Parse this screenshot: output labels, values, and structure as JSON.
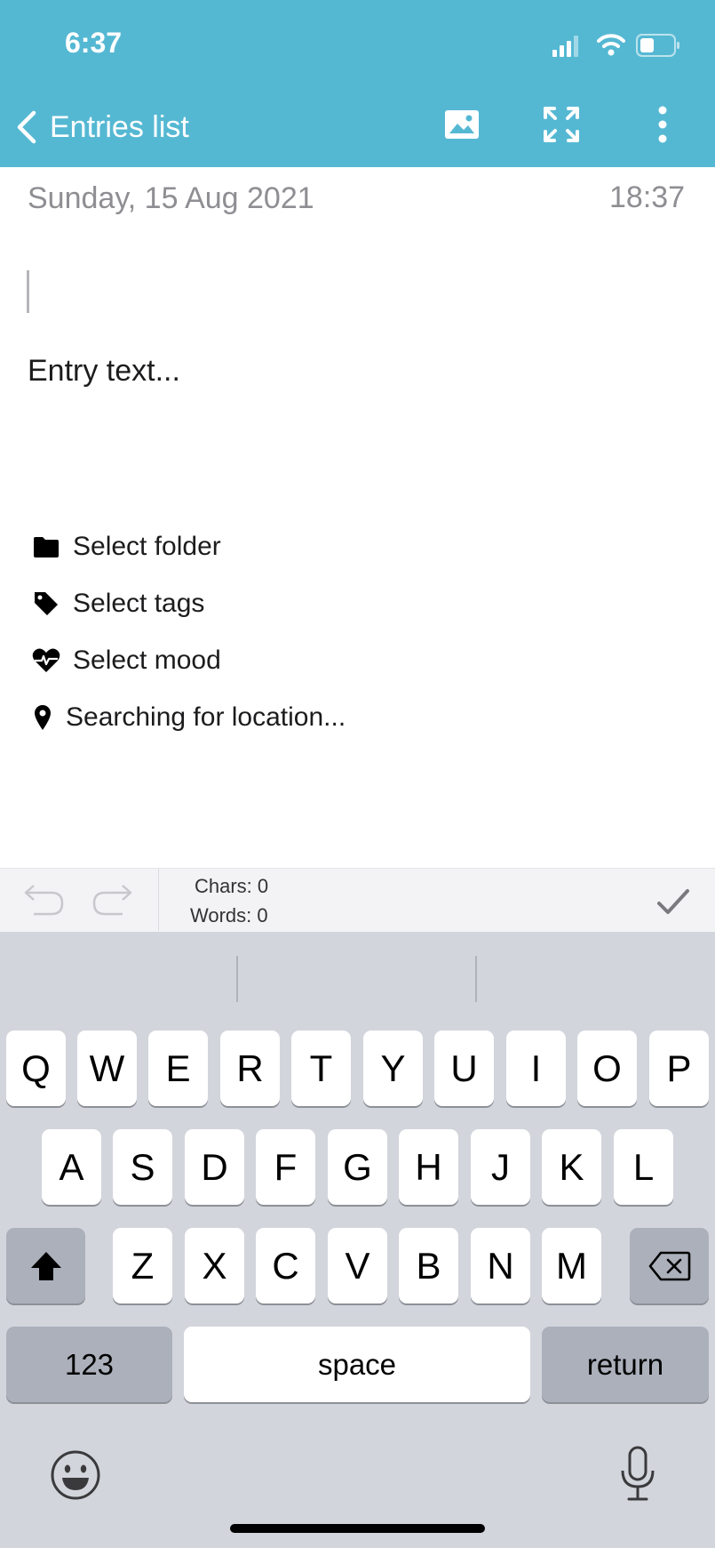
{
  "status_bar": {
    "time": "6:37"
  },
  "header": {
    "back_label": "Entries list"
  },
  "entry": {
    "date": "Sunday, 15 Aug 2021",
    "time": "18:37",
    "placeholder": "Entry text..."
  },
  "meta": {
    "folder": "Select folder",
    "tags": "Select tags",
    "mood": "Select mood",
    "location": "Searching for location..."
  },
  "toolbar": {
    "chars": "Chars: 0",
    "words": "Words: 0"
  },
  "keyboard": {
    "row1": [
      "Q",
      "W",
      "E",
      "R",
      "T",
      "Y",
      "U",
      "I",
      "O",
      "P"
    ],
    "row2": [
      "A",
      "S",
      "D",
      "F",
      "G",
      "H",
      "J",
      "K",
      "L"
    ],
    "row3": [
      "Z",
      "X",
      "C",
      "V",
      "B",
      "N",
      "M"
    ],
    "numbers_label": "123",
    "space_label": "space",
    "return_label": "return"
  },
  "colors": {
    "header": "#55b8d3",
    "keyboard_bg": "#d2d5db"
  }
}
